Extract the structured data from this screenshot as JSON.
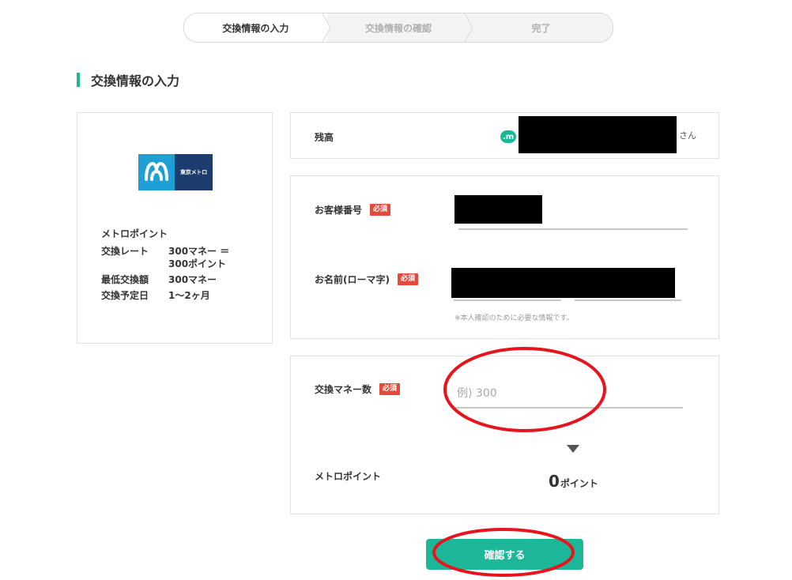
{
  "stepper": {
    "steps": [
      {
        "label": "交換情報の入力",
        "active": true
      },
      {
        "label": "交換情報の確認",
        "active": false
      },
      {
        "label": "完了",
        "active": false
      }
    ]
  },
  "section": {
    "title": "交換情報の入力"
  },
  "info_card": {
    "logo_text": "東京メトロ",
    "title": "メトロポイント",
    "rows": [
      {
        "key": "交換レート",
        "value": "300マネー ＝ 300ポイント"
      },
      {
        "key": "最低交換額",
        "value": "300マネー"
      },
      {
        "key": "交換予定日",
        "value": "1〜2ヶ月"
      }
    ]
  },
  "balance": {
    "label": "残高",
    "icon_text": ".m",
    "suffix": "さん"
  },
  "customer": {
    "number_label": "お客様番号",
    "name_label": "お名前(ローマ字)",
    "required_badge": "必須",
    "note": "※本人確認のために必要な情報です。"
  },
  "exchange": {
    "amount_label": "交換マネー数",
    "amount_placeholder": "例) 300",
    "required_badge": "必須",
    "points_label": "メトロポイント",
    "points_value": "0",
    "points_unit": "ポイント"
  },
  "confirm_button": "確認する",
  "colors": {
    "accent": "#1cb799",
    "required": "#e34a3b",
    "annotation": "#e8141d",
    "metro_blue": "#1ea0d7",
    "metro_navy": "#1c3d6e"
  }
}
